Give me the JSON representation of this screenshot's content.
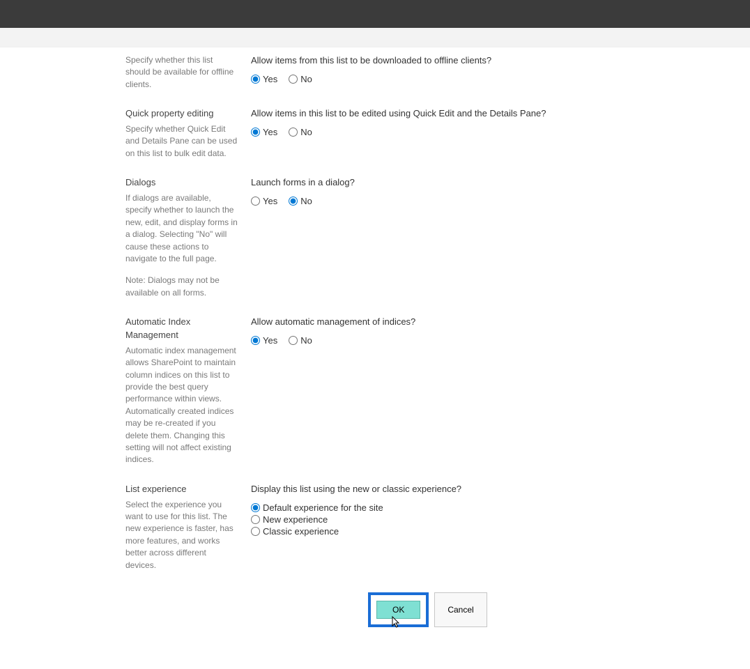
{
  "sections": {
    "offline": {
      "desc": "Specify whether this list should be available for offline clients.",
      "question": "Allow items from this list to be downloaded to offline clients?",
      "yes": "Yes",
      "no": "No"
    },
    "quickEdit": {
      "heading": "Quick property editing",
      "desc": "Specify whether Quick Edit and Details Pane can be used on this list to bulk edit data.",
      "question": "Allow items in this list to be edited using Quick Edit and the Details Pane?",
      "yes": "Yes",
      "no": "No"
    },
    "dialogs": {
      "heading": "Dialogs",
      "desc": "If dialogs are available, specify whether to launch the new, edit, and display forms in a dialog. Selecting \"No\" will cause these actions to navigate to the full page.",
      "note": "Note: Dialogs may not be available on all forms.",
      "question": "Launch forms in a dialog?",
      "yes": "Yes",
      "no": "No"
    },
    "autoIndex": {
      "heading": "Automatic Index Management",
      "desc": "Automatic index management allows SharePoint to maintain column indices on this list to provide the best query performance within views. Automatically created indices may be re-created if you delete them. Changing this setting will not affect existing indices.",
      "question": "Allow automatic management of indices?",
      "yes": "Yes",
      "no": "No"
    },
    "listExp": {
      "heading": "List experience",
      "desc": "Select the experience you want to use for this list. The new experience is faster, has more features, and works better across different devices.",
      "question": "Display this list using the new or classic experience?",
      "opt1": "Default experience for the site",
      "opt2": "New experience",
      "opt3": "Classic experience"
    }
  },
  "buttons": {
    "ok": "OK",
    "cancel": "Cancel"
  }
}
